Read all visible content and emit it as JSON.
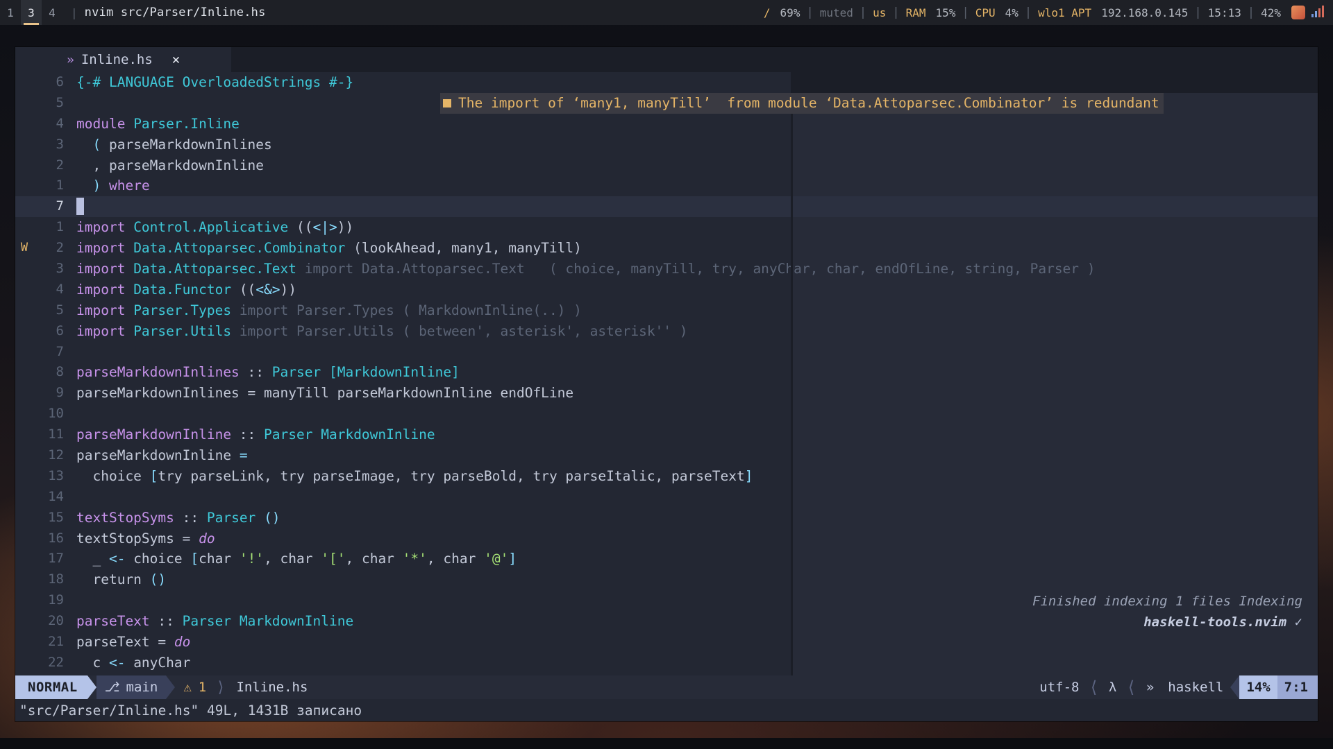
{
  "topbar": {
    "workspaces": [
      {
        "label": "1",
        "state": "normal"
      },
      {
        "label": "3",
        "state": "focused"
      },
      {
        "label": "4",
        "state": "normal"
      }
    ],
    "separator": "|",
    "window_title": "nvim src/Parser/Inline.hs",
    "status_items": [
      {
        "name": "volume",
        "icon": "/",
        "value": "69%"
      },
      {
        "name": "mute",
        "value": "muted"
      },
      {
        "name": "keyboard-layout",
        "value": "us"
      },
      {
        "name": "ram",
        "label": "RAM",
        "value": "15%"
      },
      {
        "name": "cpu",
        "label": "CPU",
        "value": "4%"
      },
      {
        "name": "network",
        "label": "wlo1 APT",
        "value": "192.168.0.145"
      },
      {
        "name": "clock",
        "value": "15:13"
      },
      {
        "name": "battery",
        "value": "42%"
      }
    ]
  },
  "tabline": {
    "lang_icon": "»",
    "filename": "Inline.hs",
    "close": "✕"
  },
  "diagnostic": {
    "marker": "■",
    "text": "The import of ‘many1, manyTill’  from module ‘Data.Attoparsec.Combinator’ is redundant"
  },
  "lsp_progress": {
    "line1_italic": "Finished indexing 1 files",
    "line1_tail": "Indexing",
    "line2_bold": "haskell-tools.nvim",
    "check": "✓"
  },
  "lines": [
    {
      "sign": "",
      "num": "6",
      "cursor": false,
      "tokens": [
        {
          "t": "{-# ",
          "c": "cmt"
        },
        {
          "t": "LANGUAGE OverloadedStrings",
          "c": "cmt"
        },
        {
          "t": " #-}",
          "c": "cmt"
        }
      ]
    },
    {
      "sign": "",
      "num": "5",
      "cursor": false,
      "tokens": []
    },
    {
      "sign": "",
      "num": "4",
      "cursor": false,
      "tokens": [
        {
          "t": "module ",
          "c": "kw"
        },
        {
          "t": "Parser.Inline",
          "c": "mod"
        }
      ]
    },
    {
      "sign": "",
      "num": "3",
      "cursor": false,
      "tokens": [
        {
          "t": "  ",
          "c": "punc"
        },
        {
          "t": "(",
          "c": "op"
        },
        {
          "t": " parseMarkdownInlines",
          "c": "punc"
        }
      ]
    },
    {
      "sign": "",
      "num": "2",
      "cursor": false,
      "tokens": [
        {
          "t": "  ",
          "c": "punc"
        },
        {
          "t": ",",
          "c": "punc"
        },
        {
          "t": " parseMarkdownInline",
          "c": "punc"
        }
      ]
    },
    {
      "sign": "",
      "num": "1",
      "cursor": false,
      "tokens": [
        {
          "t": "  ",
          "c": "punc"
        },
        {
          "t": ")",
          "c": "op"
        },
        {
          "t": " ",
          "c": "punc"
        },
        {
          "t": "where",
          "c": "kw"
        }
      ]
    },
    {
      "sign": "",
      "num": "7",
      "cursor": true,
      "tokens": [
        {
          "t": "█",
          "c": "cursor"
        }
      ]
    },
    {
      "sign": "",
      "num": "1",
      "cursor": false,
      "tokens": [
        {
          "t": "import ",
          "c": "kw"
        },
        {
          "t": "Control.Applicative",
          "c": "mod"
        },
        {
          "t": " ((",
          "c": "punc"
        },
        {
          "t": "<|>",
          "c": "op"
        },
        {
          "t": "))",
          "c": "punc"
        }
      ]
    },
    {
      "sign": "W",
      "num": "2",
      "cursor": false,
      "tokens": [
        {
          "t": "import ",
          "c": "kw"
        },
        {
          "t": "Data.Attoparsec.Combinator",
          "c": "mod"
        },
        {
          "t": " (lookAhead, many1, manyTill)",
          "c": "punc"
        }
      ]
    },
    {
      "sign": "",
      "num": "3",
      "cursor": false,
      "tokens": [
        {
          "t": "import ",
          "c": "kw"
        },
        {
          "t": "Data.Attoparsec.Text",
          "c": "mod"
        },
        {
          "t": " import Data.Attoparsec.Text   ( choice, manyTill, try, anyChar, char, endOfLine, string, Parser )",
          "c": "ghost"
        }
      ]
    },
    {
      "sign": "",
      "num": "4",
      "cursor": false,
      "tokens": [
        {
          "t": "import ",
          "c": "kw"
        },
        {
          "t": "Data.Functor",
          "c": "mod"
        },
        {
          "t": " ((",
          "c": "punc"
        },
        {
          "t": "<&>",
          "c": "op"
        },
        {
          "t": "))",
          "c": "punc"
        }
      ]
    },
    {
      "sign": "",
      "num": "5",
      "cursor": false,
      "tokens": [
        {
          "t": "import ",
          "c": "kw"
        },
        {
          "t": "Parser.Types",
          "c": "mod"
        },
        {
          "t": " import Parser.Types ( MarkdownInline(..) )",
          "c": "ghost"
        }
      ]
    },
    {
      "sign": "",
      "num": "6",
      "cursor": false,
      "tokens": [
        {
          "t": "import ",
          "c": "kw"
        },
        {
          "t": "Parser.Utils",
          "c": "mod"
        },
        {
          "t": " import Parser.Utils ( between', asterisk', asterisk'' )",
          "c": "ghost"
        }
      ]
    },
    {
      "sign": "",
      "num": "7",
      "cursor": false,
      "tokens": []
    },
    {
      "sign": "",
      "num": "8",
      "cursor": false,
      "tokens": [
        {
          "t": "parseMarkdownInlines",
          "c": "fn"
        },
        {
          "t": " :: ",
          "c": "punc"
        },
        {
          "t": "Parser",
          "c": "type"
        },
        {
          "t": " ",
          "c": "punc"
        },
        {
          "t": "[MarkdownInline]",
          "c": "type"
        }
      ]
    },
    {
      "sign": "",
      "num": "9",
      "cursor": false,
      "tokens": [
        {
          "t": "parseMarkdownInlines = manyTill parseMarkdownInline endOfLine",
          "c": "punc"
        }
      ]
    },
    {
      "sign": "",
      "num": "10",
      "cursor": false,
      "tokens": []
    },
    {
      "sign": "",
      "num": "11",
      "cursor": false,
      "tokens": [
        {
          "t": "parseMarkdownInline",
          "c": "fn"
        },
        {
          "t": " :: ",
          "c": "punc"
        },
        {
          "t": "Parser",
          "c": "type"
        },
        {
          "t": " ",
          "c": "punc"
        },
        {
          "t": "MarkdownInline",
          "c": "type"
        }
      ]
    },
    {
      "sign": "",
      "num": "12",
      "cursor": false,
      "tokens": [
        {
          "t": "parseMarkdownInline ",
          "c": "punc"
        },
        {
          "t": "=",
          "c": "op"
        }
      ]
    },
    {
      "sign": "",
      "num": "13",
      "cursor": false,
      "tokens": [
        {
          "t": "  choice ",
          "c": "punc"
        },
        {
          "t": "[",
          "c": "op"
        },
        {
          "t": "try parseLink, try parseImage, try parseBold, try parseItalic, parseText",
          "c": "punc"
        },
        {
          "t": "]",
          "c": "op"
        }
      ]
    },
    {
      "sign": "",
      "num": "14",
      "cursor": false,
      "tokens": []
    },
    {
      "sign": "",
      "num": "15",
      "cursor": false,
      "tokens": [
        {
          "t": "textStopSyms",
          "c": "fn"
        },
        {
          "t": " :: ",
          "c": "punc"
        },
        {
          "t": "Parser",
          "c": "type"
        },
        {
          "t": " ",
          "c": "punc"
        },
        {
          "t": "()",
          "c": "op"
        }
      ]
    },
    {
      "sign": "",
      "num": "16",
      "cursor": false,
      "tokens": [
        {
          "t": "textStopSyms = ",
          "c": "punc"
        },
        {
          "t": "do",
          "c": "ital"
        }
      ]
    },
    {
      "sign": "",
      "num": "17",
      "cursor": false,
      "tokens": [
        {
          "t": "  _ ",
          "c": "punc"
        },
        {
          "t": "<-",
          "c": "op"
        },
        {
          "t": " choice ",
          "c": "punc"
        },
        {
          "t": "[",
          "c": "op"
        },
        {
          "t": "char ",
          "c": "punc"
        },
        {
          "t": "'!'",
          "c": "str"
        },
        {
          "t": ", char ",
          "c": "punc"
        },
        {
          "t": "'['",
          "c": "str"
        },
        {
          "t": ", char ",
          "c": "punc"
        },
        {
          "t": "'*'",
          "c": "str"
        },
        {
          "t": ", char ",
          "c": "punc"
        },
        {
          "t": "'@'",
          "c": "str"
        },
        {
          "t": "]",
          "c": "op"
        }
      ]
    },
    {
      "sign": "",
      "num": "18",
      "cursor": false,
      "tokens": [
        {
          "t": "  return ",
          "c": "punc"
        },
        {
          "t": "()",
          "c": "op"
        }
      ]
    },
    {
      "sign": "",
      "num": "19",
      "cursor": false,
      "tokens": []
    },
    {
      "sign": "",
      "num": "20",
      "cursor": false,
      "tokens": [
        {
          "t": "parseText",
          "c": "fn"
        },
        {
          "t": " :: ",
          "c": "punc"
        },
        {
          "t": "Parser",
          "c": "type"
        },
        {
          "t": " ",
          "c": "punc"
        },
        {
          "t": "MarkdownInline",
          "c": "type"
        }
      ]
    },
    {
      "sign": "",
      "num": "21",
      "cursor": false,
      "tokens": [
        {
          "t": "parseText = ",
          "c": "punc"
        },
        {
          "t": "do",
          "c": "ital"
        }
      ]
    },
    {
      "sign": "",
      "num": "22",
      "cursor": false,
      "tokens": [
        {
          "t": "  c ",
          "c": "punc"
        },
        {
          "t": "<-",
          "c": "op"
        },
        {
          "t": " anyChar",
          "c": "punc"
        }
      ]
    }
  ],
  "statusline": {
    "mode": "NORMAL",
    "branch_icon": "⎇",
    "branch": "main",
    "diag_icon": "⚠",
    "diag_count": "1",
    "filename": "Inline.hs",
    "encoding": "utf-8",
    "lsp_icon": "λ",
    "filetype_icon": "»",
    "filetype": "haskell",
    "percent": "14%",
    "location": "7:1"
  },
  "cmdline": {
    "message": "\"src/Parser/Inline.hs\" 49L, 1431B записано"
  },
  "colors": {
    "accent_amber": "#e5b567",
    "accent_cyan": "#3fc8d8",
    "accent_purple": "#c792ea",
    "bg_editor": "#232733",
    "bg_statusbar": "#1e2026"
  }
}
